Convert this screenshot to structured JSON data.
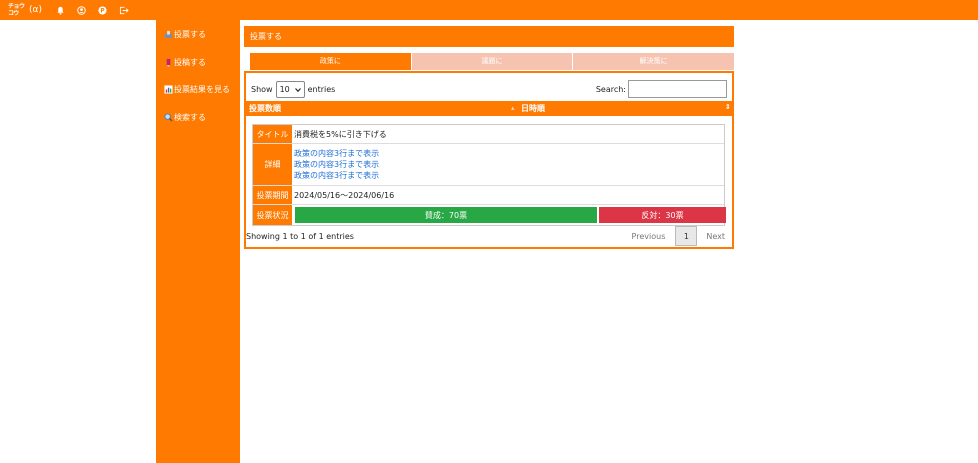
{
  "app": {
    "logo_text": "チョウコウ",
    "logo_suffix": "(α)",
    "accent_color": "#ff7a00",
    "icons": [
      "bell-icon",
      "user-circle-icon",
      "p-badge-icon",
      "logout-icon"
    ]
  },
  "sidebar": {
    "items": [
      {
        "label": "投票する",
        "icon": "ballot-box-icon"
      },
      {
        "label": "投稿する",
        "icon": "pencil-icon"
      },
      {
        "label": "投票結果を見る",
        "icon": "bar-chart-icon"
      },
      {
        "label": "検索する",
        "icon": "magnifier-icon"
      }
    ]
  },
  "page": {
    "title": "投票する",
    "tabs": [
      {
        "label": "政策に",
        "active": true
      },
      {
        "label": "議題に",
        "active": false
      },
      {
        "label": "解決策に",
        "active": false
      }
    ]
  },
  "table": {
    "show_label": "Show",
    "entries_value": "10",
    "entries_label": "entries",
    "search_label": "Search:",
    "search_value": "",
    "columns": [
      "投票数順",
      "日時順"
    ],
    "card": {
      "title_label": "タイトル",
      "title_value": "消費税を5%に引き下げる",
      "detail_label": "詳細",
      "detail_lines": [
        "政策の内容3行まで表示",
        "政策の内容3行まで表示",
        "政策の内容3行まで表示"
      ],
      "period_label": "投票期間",
      "period_value": "2024/05/16〜2024/06/16",
      "status_label": "投票状況",
      "agree_label": "賛成：70票",
      "oppose_label": "反対：30票",
      "agree_color": "#28a745",
      "oppose_color": "#dc3545"
    },
    "info": "Showing 1 to 1 of 1 entries",
    "pager": {
      "previous": "Previous",
      "current": "1",
      "next": "Next"
    }
  }
}
